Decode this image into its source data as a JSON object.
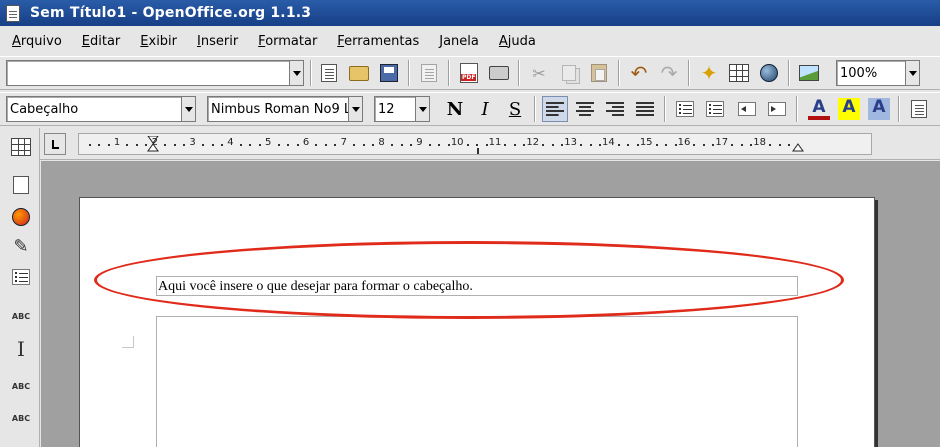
{
  "window": {
    "title": "Sem Título1 - OpenOffice.org 1.1.3"
  },
  "menu": [
    "Arquivo",
    "Editar",
    "Exibir",
    "Inserir",
    "Formatar",
    "Ferramentas",
    "Janela",
    "Ajuda"
  ],
  "toolbar": {
    "url_value": "",
    "zoom_value": "100%"
  },
  "format_bar": {
    "style_value": "Cabeçalho",
    "font_value": "Nimbus Roman No9 L",
    "size_value": "12",
    "bold_label": "N",
    "italic_label": "I",
    "underline_label": "S",
    "font_color_label": "A",
    "highlight_label": "A",
    "background_label": "A"
  },
  "ruler": {
    "numbers": [
      "1",
      "2",
      "3",
      "4",
      "5",
      "6",
      "7",
      "8",
      "9",
      "10",
      "11",
      "12",
      "13",
      "14",
      "15",
      "16",
      "17",
      "18"
    ]
  },
  "sidebar": {
    "autospell_label": "ABC",
    "spellcheck_label": "ABC",
    "spellcheck2_label": "ABC"
  },
  "document": {
    "header_text": "Aqui você insere o que desejar para formar o cabeçalho."
  },
  "colors": {
    "annotation": "#e02a1a",
    "titlebar": "#1f4f9a",
    "font_color": "#b01010",
    "highlight": "#ffff00",
    "background": "#a0b8e0"
  }
}
